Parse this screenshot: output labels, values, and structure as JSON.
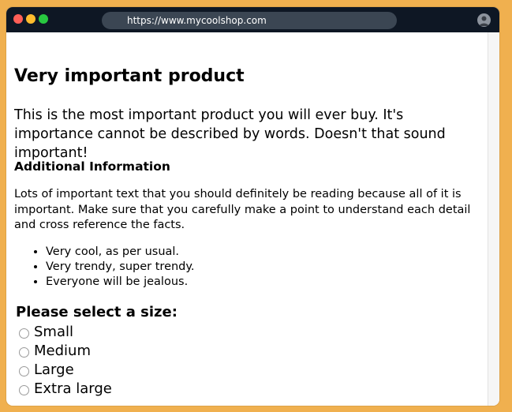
{
  "browser": {
    "url": "https://www.mycoolshop.com",
    "avatar_icon": "user-avatar-icon",
    "traffic_lights": {
      "close": "#FF5F57",
      "minimize": "#FEBC2E",
      "maximize": "#28C840"
    }
  },
  "colors": {
    "background": "#F0B04F",
    "titlebar": "#0E1724",
    "urlbar": "#3B4653"
  },
  "product": {
    "title": "Very important product",
    "description": "This is the most important product you will ever buy. It's importance cannot be described by words. Doesn't that sound important!",
    "additional_heading": "Additional Information",
    "additional_text": "Lots of important text that you should definitely be reading because all of it is important. Make sure that you carefully make a point to understand each detail and cross reference the facts.",
    "features": [
      "Very cool, as per usual.",
      "Very trendy, super trendy.",
      "Everyone will be jealous."
    ]
  },
  "size_selector": {
    "title": "Please select a size:",
    "options": [
      {
        "label": "Small",
        "selected": false
      },
      {
        "label": "Medium",
        "selected": false
      },
      {
        "label": "Large",
        "selected": false
      },
      {
        "label": "Extra large",
        "selected": false
      }
    ]
  }
}
